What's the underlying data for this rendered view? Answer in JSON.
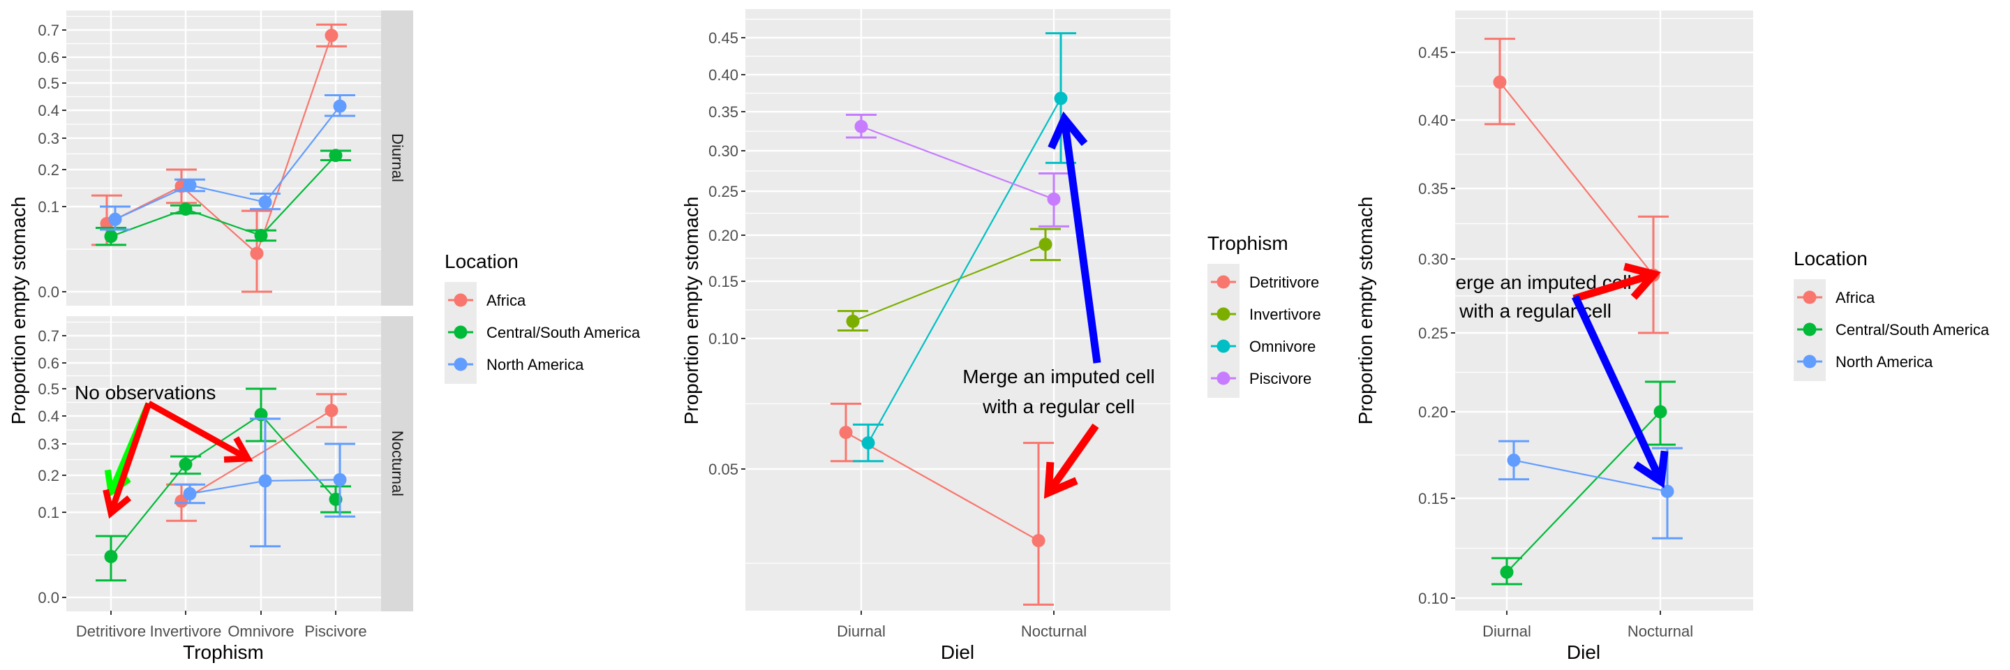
{
  "chart_data": [
    {
      "id": "left",
      "type": "line",
      "title": "",
      "xlabel": "Trophism",
      "ylabel": "Proportion empty stomach",
      "categories": [
        "Detritivore",
        "Invertivore",
        "Omnivore",
        "Piscivore"
      ],
      "y_ticks": [
        "0.0",
        "0.1",
        "0.2",
        "0.3",
        "0.4",
        "0.5",
        "0.6",
        "0.7"
      ],
      "y_scale": "transformed (non-linear)",
      "facets": [
        {
          "strip": "Diurnal",
          "series": [
            {
              "name": "Africa",
              "values": [
                0.08,
                0.155,
                0.045,
                0.68
              ],
              "lower": [
                0.055,
                0.11,
                0.0,
                0.64
              ],
              "upper": [
                0.13,
                0.2,
                0.095,
                0.72
              ]
            },
            {
              "name": "Central/South America",
              "values": [
                0.065,
                0.097,
                0.066,
                0.245
              ],
              "lower": [
                0.055,
                0.092,
                0.06,
                0.23
              ],
              "upper": [
                0.075,
                0.103,
                0.072,
                0.26
              ]
            },
            {
              "name": "North America",
              "values": [
                0.085,
                0.158,
                0.112,
                0.415
              ],
              "lower": [
                0.073,
                0.142,
                0.097,
                0.38
              ],
              "upper": [
                0.1,
                0.173,
                0.135,
                0.455
              ]
            }
          ]
        },
        {
          "strip": "Nocturnal",
          "series": [
            {
              "name": "Africa",
              "values": [
                null,
                0.13,
                null,
                0.42
              ],
              "lower": [
                null,
                0.09,
                null,
                0.36
              ],
              "upper": [
                null,
                0.175,
                null,
                0.48
              ]
            },
            {
              "name": "Central/South America",
              "values": [
                0.048,
                0.235,
                0.405,
                0.135
              ],
              "lower": [
                0.02,
                0.205,
                0.31,
                0.1
              ],
              "upper": [
                0.072,
                0.26,
                0.5,
                0.17
              ]
            },
            {
              "name": "North America",
              "values": [
                null,
                0.15,
                0.185,
                0.188
              ],
              "lower": [
                null,
                0.125,
                0.06,
                0.095
              ],
              "upper": [
                null,
                0.175,
                0.39,
                0.3
              ]
            }
          ]
        }
      ],
      "legend": {
        "title": "Location",
        "position": "right",
        "entries": [
          "Africa",
          "Central/South America",
          "North America"
        ]
      },
      "annotations": [
        {
          "text": "No observations",
          "arrows": [
            "red arrow to Detritivore (Nocturnal)",
            "green arrow to Detritivore (Nocturnal)",
            "red arrow toward Omnivore (Nocturnal)"
          ]
        }
      ]
    },
    {
      "id": "middle",
      "type": "line",
      "title": "",
      "xlabel": "Diel",
      "ylabel": "Proportion empty stomach",
      "categories": [
        "Diurnal",
        "Nocturnal"
      ],
      "y_ticks": [
        "0.05",
        "0.10",
        "0.15",
        "0.20",
        "0.25",
        "0.30",
        "0.35",
        "0.40",
        "0.45"
      ],
      "y_scale": "transformed (non-linear)",
      "series": [
        {
          "name": "Detritivore",
          "values": [
            0.064,
            0.031
          ],
          "lower": [
            0.053,
            0.014
          ],
          "upper": [
            0.075,
            0.06
          ]
        },
        {
          "name": "Invertivore",
          "values": [
            0.115,
            0.19
          ],
          "lower": [
            0.107,
            0.173
          ],
          "upper": [
            0.124,
            0.207
          ]
        },
        {
          "name": "Omnivore",
          "values": [
            0.06,
            0.368
          ],
          "lower": [
            0.053,
            0.285
          ],
          "upper": [
            0.067,
            0.456
          ]
        },
        {
          "name": "Piscivore",
          "values": [
            0.331,
            0.241
          ],
          "lower": [
            0.317,
            0.21
          ],
          "upper": [
            0.346,
            0.272
          ]
        }
      ],
      "legend": {
        "title": "Trophism",
        "position": "right",
        "entries": [
          "Detritivore",
          "Invertivore",
          "Omnivore",
          "Piscivore"
        ]
      },
      "annotations": [
        {
          "text_lines": [
            "Merge an imputed cell",
            "with a regular cell"
          ],
          "arrows": [
            "blue arrow to Omnivore Nocturnal",
            "red arrow to Detritivore Nocturnal"
          ]
        }
      ]
    },
    {
      "id": "right",
      "type": "line",
      "title": "",
      "xlabel": "Diel",
      "ylabel": "Proportion empty stomach",
      "categories": [
        "Diurnal",
        "Nocturnal"
      ],
      "y_ticks": [
        "0.10",
        "0.15",
        "0.20",
        "0.25",
        "0.30",
        "0.35",
        "0.40",
        "0.45"
      ],
      "y_scale": "transformed (non-linear)",
      "series": [
        {
          "name": "Africa",
          "values": [
            0.428,
            0.289
          ],
          "lower": [
            0.397,
            0.25
          ],
          "upper": [
            0.46,
            0.33
          ]
        },
        {
          "name": "Central/South America",
          "values": [
            0.113,
            0.2
          ],
          "lower": [
            0.107,
            0.181
          ],
          "upper": [
            0.12,
            0.219
          ]
        },
        {
          "name": "North America",
          "values": [
            0.172,
            0.154
          ],
          "lower": [
            0.161,
            0.13
          ],
          "upper": [
            0.183,
            0.179
          ]
        }
      ],
      "legend": {
        "title": "Location",
        "position": "right",
        "entries": [
          "Africa",
          "Central/South America",
          "North America"
        ]
      },
      "annotations": [
        {
          "text_lines": [
            "Merge an imputed cell",
            "with a regular cell"
          ],
          "arrows": [
            "red arrow to Africa Nocturnal",
            "blue arrow to North America Nocturnal"
          ]
        }
      ]
    }
  ],
  "colors": {
    "Africa": "#F8766D",
    "Central/South America": "#00BA38",
    "North America": "#619CFF",
    "Detritivore": "#F8766D",
    "Invertivore": "#7CAE00",
    "Omnivore": "#00BFC4",
    "Piscivore": "#C77CFF",
    "panel_bg": "#EBEBEB",
    "strip_bg": "#D9D9D9",
    "annotation_red": "#FF0000",
    "annotation_green": "#00FF00",
    "annotation_blue": "#0000FF"
  }
}
